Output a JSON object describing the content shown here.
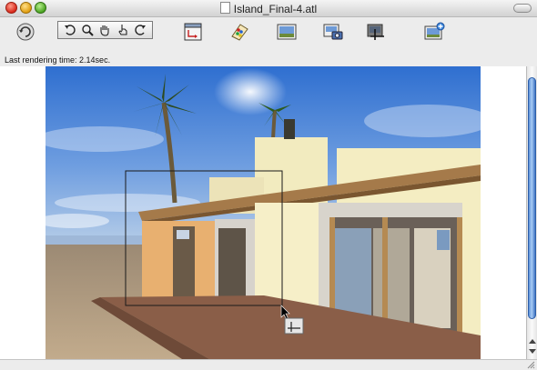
{
  "window": {
    "title": "Island_Final-4.atl"
  },
  "toolbar": {
    "buttons": [
      {
        "name": "rotate-view-button",
        "icon": "refresh-circle-icon"
      },
      {
        "name": "undo-view-button",
        "icon": "undo-arrow-icon"
      },
      {
        "name": "zoom-button",
        "icon": "magnifier-icon"
      },
      {
        "name": "pan-hand-button",
        "icon": "hand-icon"
      },
      {
        "name": "select-hand-button",
        "icon": "pointing-hand-icon"
      },
      {
        "name": "redo-view-button",
        "icon": "redo-arrow-icon"
      },
      {
        "name": "frame-crop-button",
        "icon": "window-crop-icon"
      },
      {
        "name": "palette-button",
        "icon": "color-palette-icon"
      },
      {
        "name": "render-image-button",
        "icon": "landscape-image-icon"
      },
      {
        "name": "camera-render-button",
        "icon": "camera-image-icon"
      },
      {
        "name": "render-region-button",
        "icon": "crop-region-icon"
      },
      {
        "name": "add-image-button",
        "icon": "image-plus-icon"
      }
    ]
  },
  "status": {
    "text": "Last rendering time: 2.14sec."
  },
  "colors": {
    "sky_top": "#2f6fd0",
    "sky_bottom": "#b9cfe8",
    "sand": "#b09a7e",
    "wall_cream": "#f4edc2",
    "wall_orange": "#e8b070",
    "scroll_thumb": "#5a8fd8"
  }
}
